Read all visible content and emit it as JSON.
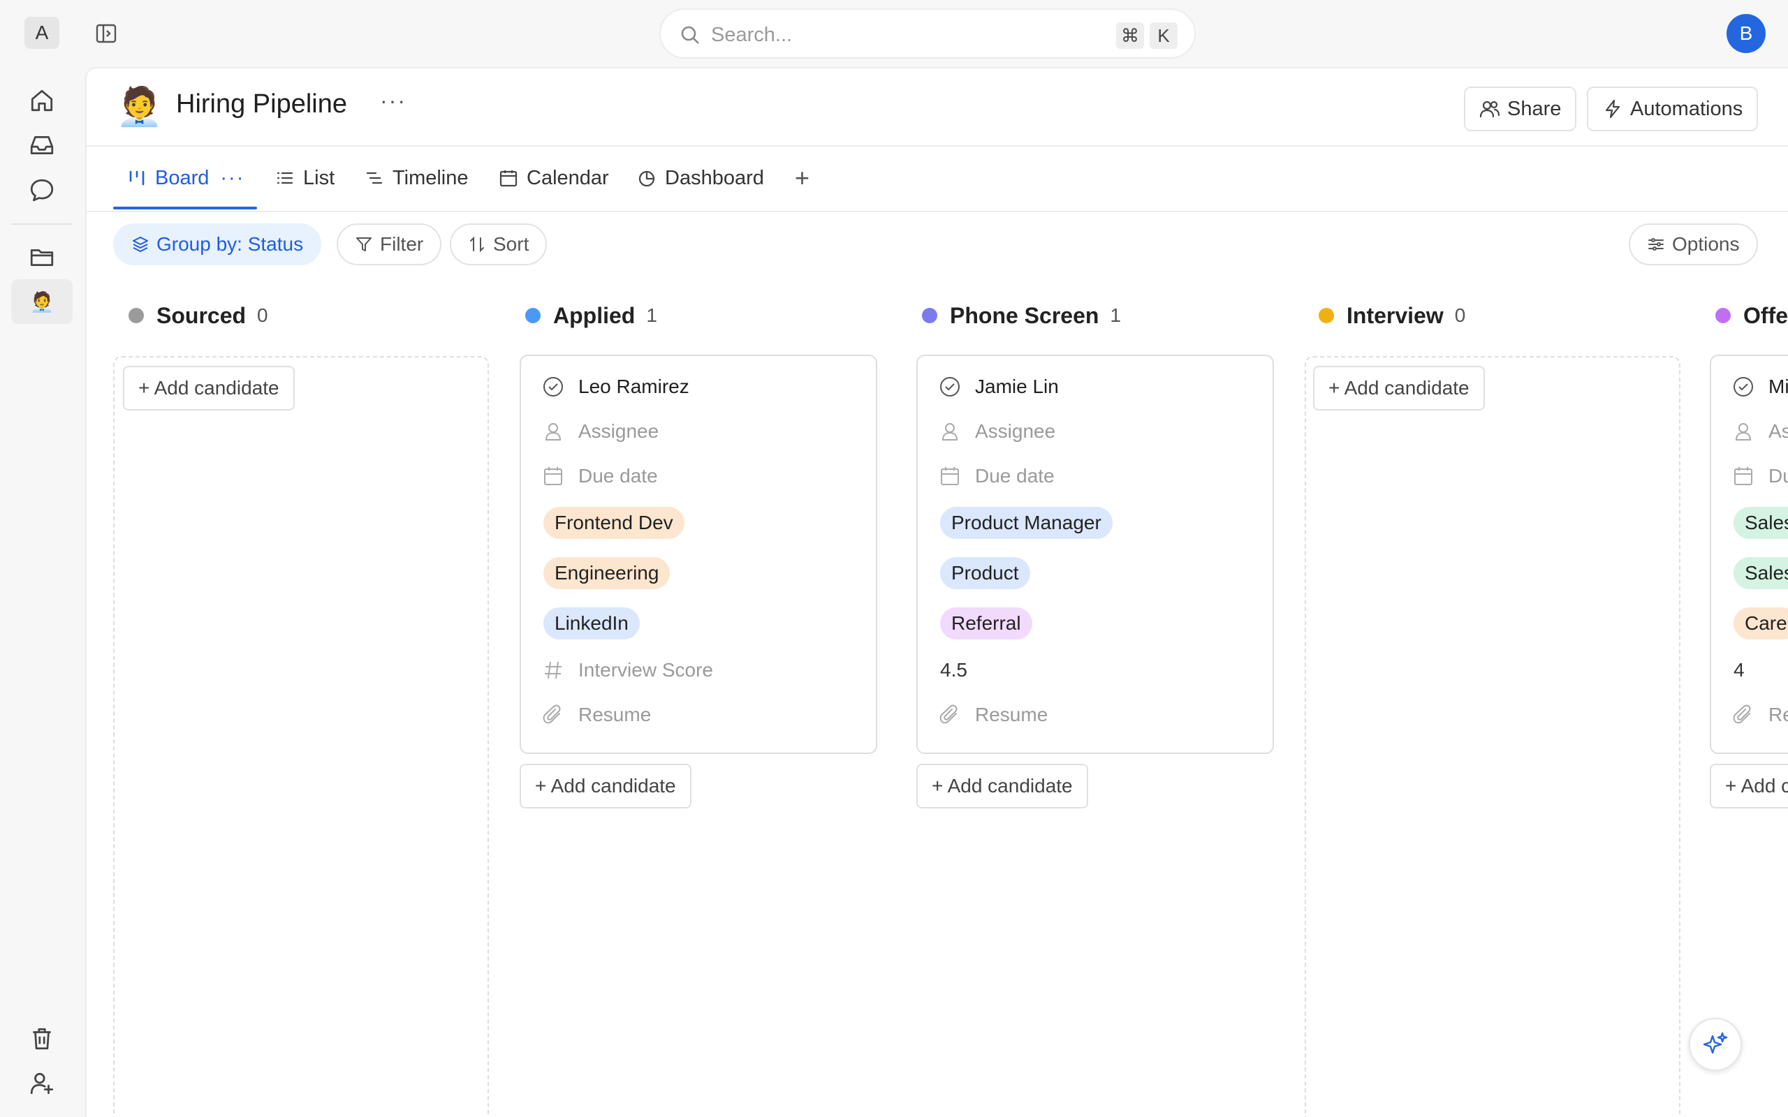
{
  "workspace": {
    "initial": "A"
  },
  "search": {
    "placeholder": "Search...",
    "shortcut_mod": "⌘",
    "shortcut_key": "K"
  },
  "user": {
    "initial": "B"
  },
  "sidebar": {
    "items": [
      {
        "icon": "home-icon"
      },
      {
        "icon": "inbox-icon"
      },
      {
        "icon": "chat-icon"
      },
      {
        "icon": "folder-icon"
      },
      {
        "icon": "page-emoji",
        "emoji": "🧑‍💼"
      }
    ],
    "bottom": [
      {
        "icon": "trash-icon"
      },
      {
        "icon": "add-user-icon"
      }
    ]
  },
  "page": {
    "emoji": "🧑‍💼",
    "title": "Hiring Pipeline",
    "more": "···",
    "share_label": "Share",
    "automations_label": "Automations"
  },
  "tabs": [
    {
      "label": "Board",
      "active": true,
      "more": "···"
    },
    {
      "label": "List"
    },
    {
      "label": "Timeline"
    },
    {
      "label": "Calendar"
    },
    {
      "label": "Dashboard"
    }
  ],
  "add_tab": "+",
  "toolbar": {
    "group_label": "Group by: Status",
    "filter_label": "Filter",
    "sort_label": "Sort",
    "options_label": "Options"
  },
  "colors": {
    "accent": "#1e5ce6",
    "sourced": "#9b9b9b",
    "applied": "#4a9af5",
    "phone_screen": "#7b7bf0",
    "interview": "#f2b010",
    "offer": "#c06ff5"
  },
  "board": {
    "add_candidate": "+ Add candidate",
    "columns": [
      {
        "name": "Sourced",
        "count": "0"
      },
      {
        "name": "Applied",
        "count": "1"
      },
      {
        "name": "Phone Screen",
        "count": "1"
      },
      {
        "name": "Interview",
        "count": "0"
      },
      {
        "name": "Offer"
      }
    ],
    "cards": [
      {
        "name": "Leo Ramirez",
        "assignee": "Assignee",
        "due_date": "Due date",
        "tags": [
          "Frontend Dev",
          "Engineering",
          "LinkedIn"
        ],
        "interview_score": "Interview Score",
        "resume": "Resume"
      },
      {
        "name": "Jamie Lin",
        "assignee": "Assignee",
        "due_date": "Due date",
        "tags": [
          "Product Manager",
          "Product",
          "Referral"
        ],
        "interview_score": "4.5",
        "resume": "Resume"
      },
      {
        "name": "Mi",
        "assignee": "As",
        "due_date": "Du",
        "tags": [
          "Sales",
          "Sales",
          "Care"
        ],
        "interview_score": "4",
        "resume": "Re"
      }
    ],
    "partial_add": "+ Add c"
  }
}
